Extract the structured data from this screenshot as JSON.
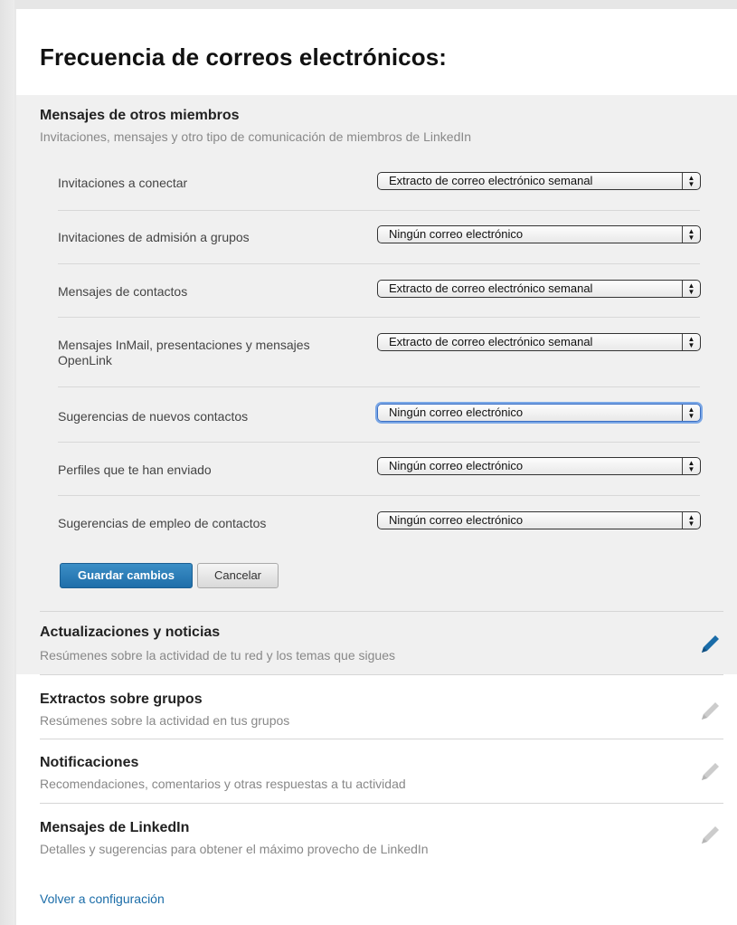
{
  "page": {
    "title": "Frecuencia de correos electrónicos:"
  },
  "sections": {
    "members": {
      "title": "Mensajes de otros miembros",
      "desc": "Invitaciones, mensajes y otro tipo de comunicación de miembros de LinkedIn",
      "rows": [
        {
          "label": "Invitaciones a conectar",
          "value": "Extracto de correo electrónico semanal"
        },
        {
          "label": "Invitaciones de admisión a grupos",
          "value": "Ningún correo electrónico"
        },
        {
          "label": "Mensajes de contactos",
          "value": "Extracto de correo electrónico semanal"
        },
        {
          "label": "Mensajes InMail, presentaciones y mensajes OpenLink",
          "value": "Extracto de correo electrónico semanal"
        },
        {
          "label": "Sugerencias de nuevos contactos",
          "value": "Ningún correo electrónico"
        },
        {
          "label": "Perfiles que te han enviado",
          "value": "Ningún correo electrónico"
        },
        {
          "label": "Sugerencias de empleo de contactos",
          "value": "Ningún correo electrónico"
        }
      ],
      "save_label": "Guardar cambios",
      "cancel_label": "Cancelar"
    },
    "updates": {
      "title": "Actualizaciones y noticias",
      "desc": "Resúmenes sobre la actividad de tu red y los temas que sigues"
    },
    "groups": {
      "title": "Extractos sobre grupos",
      "desc": "Resúmenes sobre la actividad en tus grupos"
    },
    "notifications": {
      "title": "Notificaciones",
      "desc": "Recomendaciones, comentarios y otras respuestas a tu actividad"
    },
    "linkedin": {
      "title": "Mensajes de LinkedIn",
      "desc": "Detalles y sugerencias para obtener el máximo provecho de LinkedIn"
    }
  },
  "footer": {
    "back_link": "Volver a configuración"
  },
  "colors": {
    "accent": "#1f6ea9",
    "link": "#1a6ca8",
    "edit_active": "#1a6ca8",
    "edit_inactive": "#cccccc"
  },
  "icons": {
    "edit_active": "pencil-icon",
    "edit_inactive": "pencil-icon"
  }
}
